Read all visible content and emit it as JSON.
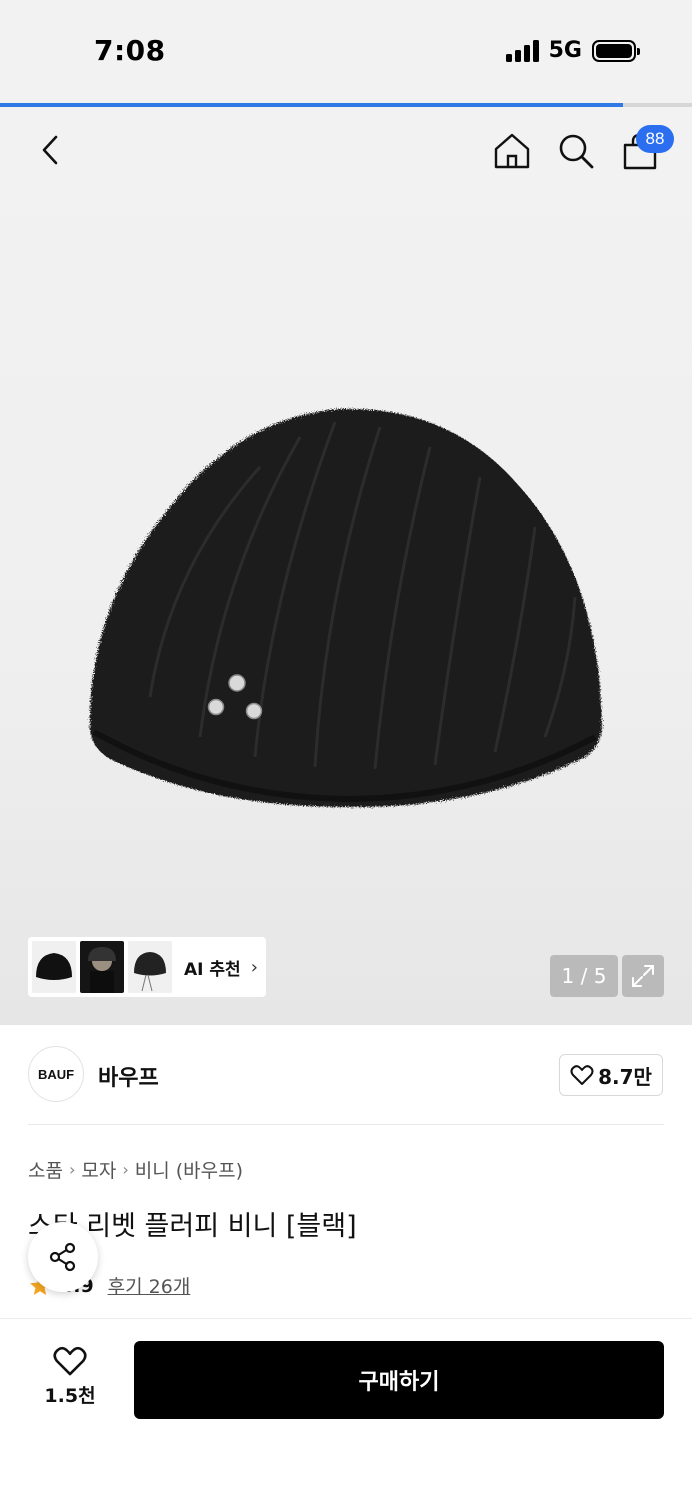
{
  "status_bar": {
    "time": "7:08",
    "network": "5G"
  },
  "loading_progress": 0.9,
  "header": {
    "cart_badge": "88"
  },
  "gallery": {
    "page_indicator": "1 / 5",
    "ai_recommend_label": "AI 추천"
  },
  "brand": {
    "logo_text": "BAUF",
    "name": "바우프",
    "like_count": "8.7만"
  },
  "breadcrumb": [
    "소품",
    "모자",
    "비니 (바우프)"
  ],
  "product": {
    "title": "스타 리벳 플러피 비니 [블랙]",
    "rating": "4.9",
    "reviews": "후기 26개"
  },
  "bottom_bar": {
    "wish_count": "1.5천",
    "buy_label": "구매하기"
  },
  "colors": {
    "accent": "#2b6ff0",
    "buy_button": "#000000",
    "star": "#f5a623"
  }
}
